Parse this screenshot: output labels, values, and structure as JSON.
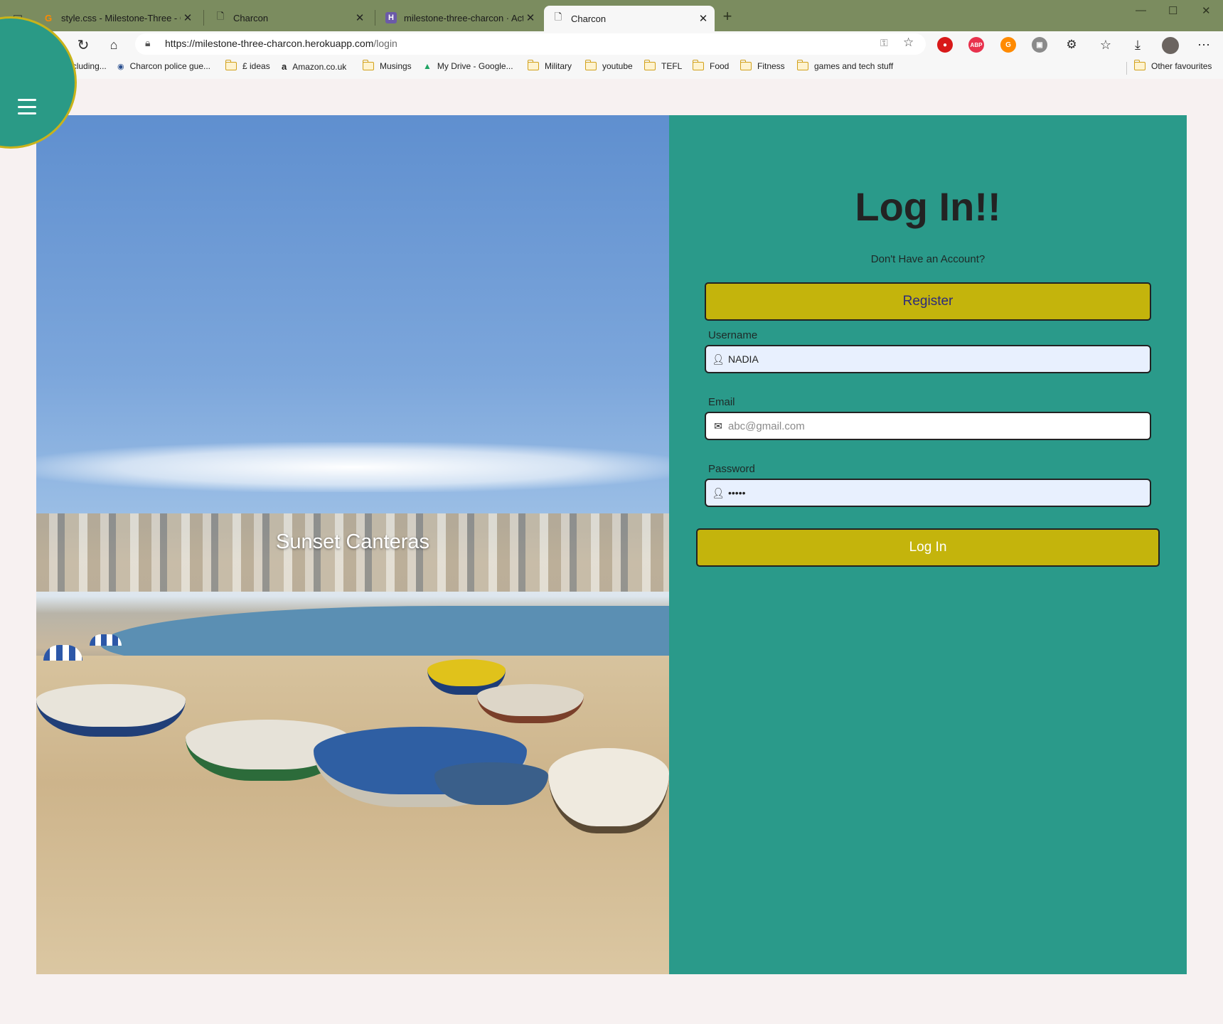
{
  "browser": {
    "tabs": [
      {
        "label": "style.css - Milestone-Three - Gitpod",
        "icon": "gitpod-icon",
        "active": false
      },
      {
        "label": "Charcon",
        "icon": "page-icon",
        "active": false
      },
      {
        "label": "milestone-three-charcon · Activity",
        "icon": "heroku-icon",
        "active": false
      },
      {
        "label": "Charcon",
        "icon": "page-icon",
        "active": true
      }
    ],
    "new_tab": "+",
    "url_host": "https://milestone-three-charcon.herokuapp.com",
    "url_path": "/login",
    "bookmarks": [
      {
        "label": "Learning, including...",
        "type": "folder"
      },
      {
        "label": "Charcon police gue...",
        "type": "site"
      },
      {
        "label": "£ ideas",
        "type": "folder"
      },
      {
        "label": "Amazon.co.uk",
        "type": "site"
      },
      {
        "label": "Musings",
        "type": "folder"
      },
      {
        "label": "My Drive - Google...",
        "type": "site"
      },
      {
        "label": "Military",
        "type": "folder"
      },
      {
        "label": "youtube",
        "type": "folder"
      },
      {
        "label": "TEFL",
        "type": "folder"
      },
      {
        "label": "Food",
        "type": "folder"
      },
      {
        "label": "Fitness",
        "type": "folder"
      },
      {
        "label": "games and tech stuff",
        "type": "folder"
      }
    ],
    "other_favourites": "Other favourites"
  },
  "hero": {
    "title": "Sunset Canteras"
  },
  "login": {
    "title": "Log In!!",
    "subtitle": "Don't Have an Account?",
    "register_label": "Register",
    "username_label": "Username",
    "username_value": "NADIA",
    "email_label": "Email",
    "email_placeholder": "abc@gmail.com",
    "password_label": "Password",
    "password_value": "•••••",
    "submit_label": "Log In"
  },
  "colors": {
    "panel": "#2a9a8a",
    "button": "#c4b40c",
    "tabstrip": "#7b8c5f"
  }
}
